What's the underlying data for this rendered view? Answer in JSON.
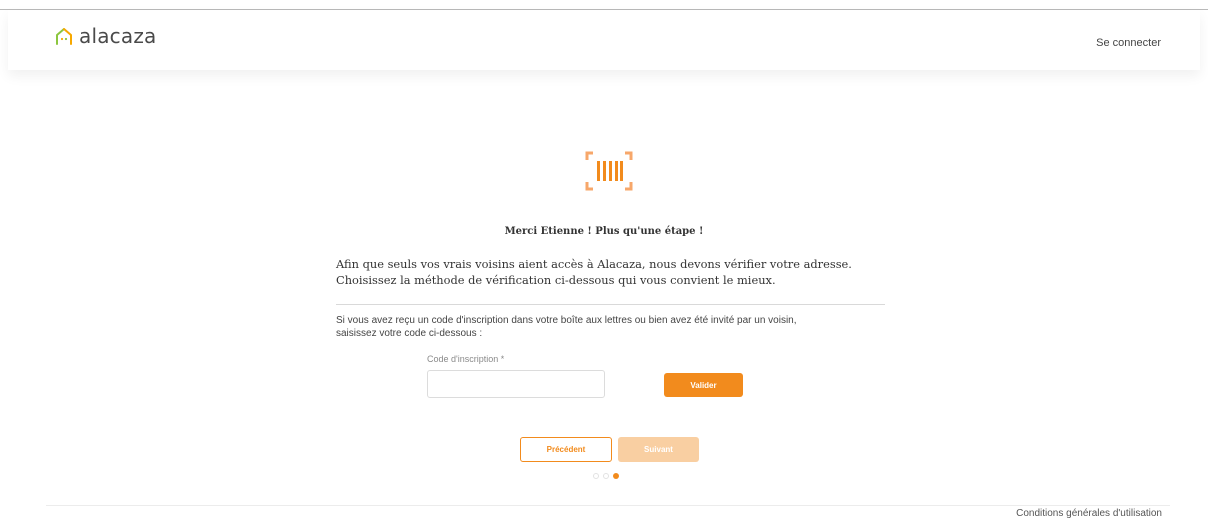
{
  "header": {
    "logo_text": "alacaza",
    "login_label": "Se connecter"
  },
  "step": {
    "icon": "barcode-scan-icon",
    "title": "Merci Etienne ! Plus qu'une étape !",
    "intro_line1": "Afin que seuls vos vrais voisins aient accès à Alacaza, nous devons vérifier votre adresse.",
    "intro_line2": "Choisissez la méthode de vérification ci-dessous qui vous convient le mieux.",
    "instruction_line1": "Si vous avez reçu un code d'inscription dans votre boîte aux lettres ou bien avez été invité par un voisin,",
    "instruction_line2": "saisissez votre code ci-dessous :"
  },
  "form": {
    "code_label": "Code d'inscription *",
    "code_value": "",
    "validate_label": "Valider"
  },
  "nav": {
    "prev_label": "Précédent",
    "next_label": "Suivant",
    "steps_total": 3,
    "current_step": 3
  },
  "footer": {
    "terms_label": "Conditions générales d'utilisation"
  },
  "colors": {
    "accent": "#f28b1d",
    "accent_disabled": "#f9cfa2",
    "logo_green": "#8cc63f",
    "logo_orange": "#f7a800"
  }
}
